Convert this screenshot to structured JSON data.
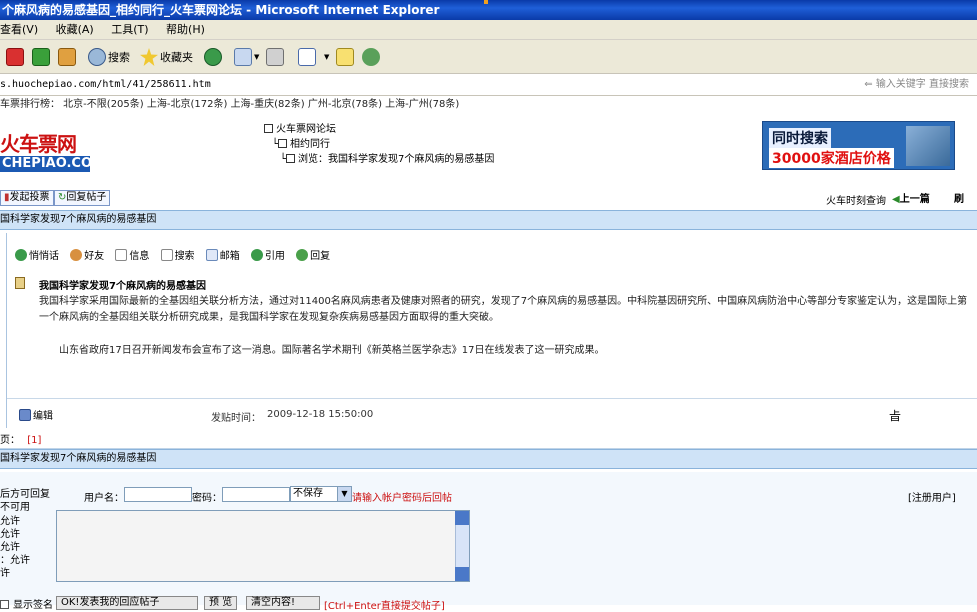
{
  "window": {
    "title": "个麻风病的易感基因_相约同行_火车票网论坛 - Microsoft Internet Explorer"
  },
  "menu": [
    "查看(V)",
    "收藏(A)",
    "工具(T)",
    "帮助(H)"
  ],
  "toolbar": {
    "search_label": "搜索",
    "favorites_label": "收藏夹"
  },
  "address": {
    "url": "s.huochepiao.com/html/41/258611.htm",
    "search_hint": "输入关键字 直接搜索"
  },
  "ranking": {
    "text": "车票排行榜：  北京-不限(205条) 上海-北京(172条) 上海-重庆(82条) 广州-北京(78条) 上海-广州(78条)"
  },
  "logo": {
    "top": "火车票网",
    "bottom": "CHEPIAO.COM"
  },
  "breadcrumb": {
    "root": "火车票网论坛",
    "forum": "相约同行",
    "current": "浏览：我国科学家发现7个麻风病的易感基因"
  },
  "ad": {
    "line1": "同时搜索",
    "line2": "30000家酒店价格"
  },
  "actions": {
    "vote": "发起投票",
    "reply": "回复帖子",
    "schedule": "火车时刻查询",
    "prev": "上一篇",
    "refresh": "刷"
  },
  "thread": {
    "title": "国科学家发现7个麻风病的易感基因"
  },
  "post": {
    "tools": [
      "悄悄话",
      "好友",
      "信息",
      "搜索",
      "邮箱",
      "引用",
      "回复"
    ],
    "heading": "我国科学家发现7个麻风病的易感基因",
    "para1": "我国科学家采用国际最新的全基因组关联分析方法，通过对11400名麻风病患者及健康对照者的研究，发现了7个麻风病的易感基因。中科院基因研究所、中国麻风病防治中心等部分专家鉴定认为，这是国际上第一个麻风病的全基因组关联分析研究成果，是我国科学家在发现复杂疾病易感基因方面取得的重大突破。",
    "para2": "山东省政府17日召开新闻发布会宣布了这一消息。国际著名学术期刊《新英格兰医学杂志》17日在线发表了这一研究成果。",
    "edit_label": "编辑",
    "time_label": "发贴时间：",
    "time_value": "2009-12-18 15:50:00",
    "mark": "㫖"
  },
  "pager": {
    "label": "页：",
    "page": "[1]"
  },
  "reply_section": {
    "title": "国科学家发现7个麻风病的易感基因"
  },
  "reply_form": {
    "side_notes": [
      "后方可回复",
      "不可用",
      "允许",
      "允许",
      "允许",
      "：允许",
      "许"
    ],
    "user_label": "用户名：",
    "pass_label": "密码：",
    "save_option": "不保存",
    "login_hint": "请输入帐户密码后回帖",
    "register": "[注册用户]",
    "signature": "显示签名",
    "submit": "OK!发表我的回应帖子",
    "preview": "预 览",
    "clear": "清空内容!",
    "shortcut": "[Ctrl+Enter直接提交帖子]"
  },
  "colors": {
    "titlebar": "#0a3aa8",
    "section": "#cfe3f7",
    "accent_red": "#cc1111"
  }
}
